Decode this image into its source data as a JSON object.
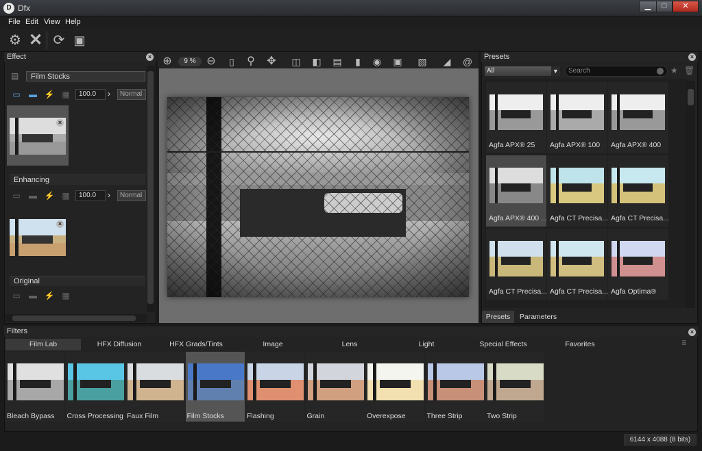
{
  "window": {
    "title": "Dfx",
    "app_icon_letter": "D",
    "min": "▁",
    "max": "□",
    "close": "✕"
  },
  "menu": [
    "File",
    "Edit",
    "View",
    "Help"
  ],
  "effect_panel": {
    "title": "Effect",
    "sections": [
      {
        "name": "Film Stocks",
        "value": "100.0",
        "mode": "Normal",
        "active": true
      },
      {
        "name": "Enhancing",
        "value": "100.0",
        "mode": "Normal",
        "active": false
      },
      {
        "name": "Original",
        "active": false
      }
    ]
  },
  "canvas_toolbar": {
    "zoom": "9 %"
  },
  "presets_panel": {
    "title": "Presets",
    "filter_select": "All",
    "search_placeholder": "Search",
    "items": [
      "Agfa APX® 25",
      "Agfa APX® 100",
      "Agfa APX® 400",
      "Agfa APX® 400 ...",
      "Agfa CT Precisa...",
      "Agfa CT Precisa...",
      "Agfa CT Precisa...",
      "Agfa CT Precisa...",
      "Agfa Optima®"
    ],
    "tabs": [
      "Presets",
      "Parameters"
    ]
  },
  "filters_panel": {
    "title": "Filters",
    "tabs": [
      "Film Lab",
      "HFX Diffusion",
      "HFX Grads/Tints",
      "Image",
      "Lens",
      "Light",
      "Special Effects",
      "Favorites"
    ],
    "items": [
      "Bleach Bypass",
      "Cross Processing",
      "Faux Film",
      "Film Stocks",
      "Flashing",
      "Grain",
      "Overexpose",
      "Three Strip",
      "Two Strip"
    ],
    "selected": "Film Stocks"
  },
  "status": {
    "image_info": "6144 x 4088 (8 bits)"
  },
  "colors": {
    "accent_blue": "#5aa0e0",
    "selected_tab": "#3a3a3a"
  }
}
